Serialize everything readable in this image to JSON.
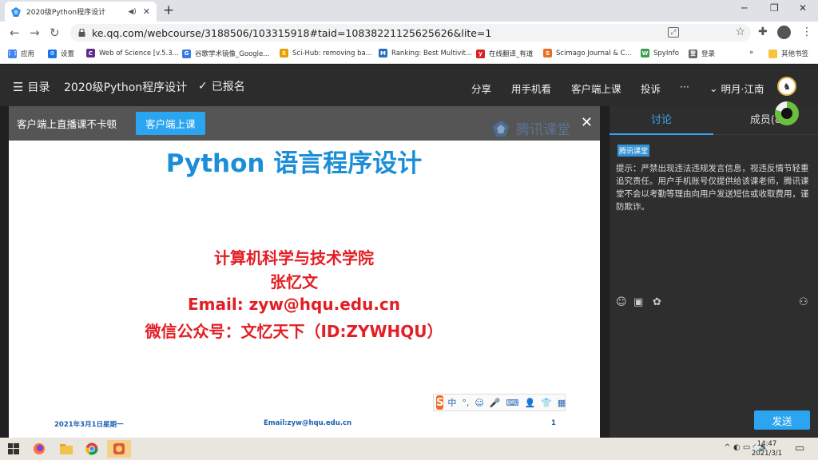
{
  "browser": {
    "tab_title": "2020级Python程序设计",
    "url": "ke.qq.com/webcourse/3188506/103315918#taid=10838221125625626&lite=1",
    "bookmarks": [
      {
        "label": "应用",
        "icon": "apps-grid-icon",
        "color": "#4285f4"
      },
      {
        "label": "设置",
        "icon": "gear-icon",
        "color": "#1a73e8"
      },
      {
        "label": "Web of Science [v.5.3...",
        "icon": "wos-icon",
        "color": "#5c2d91"
      },
      {
        "label": "谷歌学术镜像_Google...",
        "icon": "scholar-icon",
        "color": "#3b78e7"
      },
      {
        "label": "Sci-Hub: removing ba...",
        "icon": "scihub-icon",
        "color": "#e8a000"
      },
      {
        "label": "Ranking: Best Multivit...",
        "icon": "m-icon",
        "color": "#2a6ebb"
      },
      {
        "label": "在线翻译_有道",
        "icon": "youdao-icon",
        "color": "#e02020"
      },
      {
        "label": "Scimago Journal & C...",
        "icon": "sjr-icon",
        "color": "#e76f24"
      },
      {
        "label": "SpyInfo",
        "icon": "spyinfo-icon",
        "color": "#38a04a"
      },
      {
        "label": "登录",
        "icon": "login-icon",
        "color": "#666666"
      }
    ],
    "other_bookmarks": "其他书签",
    "overflow": "»"
  },
  "app": {
    "menu_label": "目录",
    "course_title": "2020级Python程序设计",
    "enrolled": "已报名",
    "nav": [
      "分享",
      "用手机看",
      "客户端上课",
      "投诉",
      "···"
    ],
    "user": "明月·江南"
  },
  "video": {
    "banner_text": "客户端上直播课不卡顿",
    "banner_button": "客户端上课",
    "watermark": "腾讯课堂",
    "slide": {
      "title": "Python 语言程序设计",
      "lines": [
        "计算机科学与技术学院",
        "张忆文",
        "Email: zyw@hqu.edu.cn",
        "微信公众号：文忆天下（ID:ZYWHQU）"
      ],
      "footer_date": "2021年3月1日星期一",
      "footer_email": "Email:zyw@hqu.edu.cn",
      "footer_page": "1"
    },
    "ime": {
      "logo": "S",
      "items": [
        "中",
        "°,",
        "☺",
        "🎤",
        "⌨",
        "👤",
        "👕",
        "▦"
      ]
    }
  },
  "panel": {
    "tab_discuss": "讨论",
    "tab_members": "成员(8",
    "notice_badge": "腾讯课堂",
    "notice_text": "提示：严禁出现违法违规发言信息，视违反情节轻重追究责任。用户手机账号仅提供给该课老师，腾讯课堂不会以考勤等理由向用户发送短信或收取费用，谨防欺诈。",
    "send": "发送"
  },
  "taskbar": {
    "time": "14:47",
    "date": "2021/3/1",
    "tray": "^ ◐ ▭ ◜ 🔈"
  },
  "colors": {
    "accent": "#2ba5f0",
    "slide_title": "#1c8ed8",
    "slide_red": "#e31e24"
  }
}
